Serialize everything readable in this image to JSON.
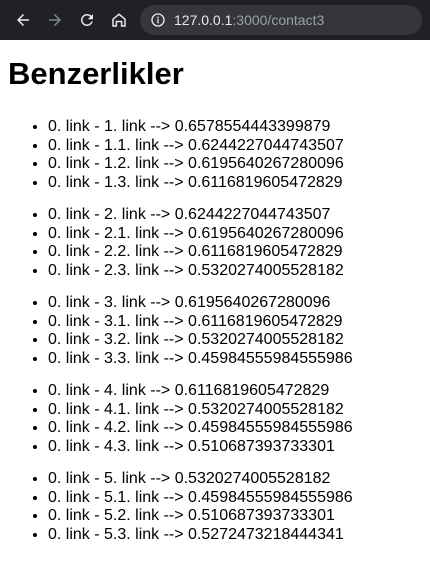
{
  "browser": {
    "url_host": "127.0.0.1",
    "url_rest": ":3000/contact3"
  },
  "page": {
    "title": "Benzerlikler",
    "groups": [
      {
        "items": [
          "0. link - 1. link --> 0.6578554443399879",
          "0. link - 1.1. link --> 0.6244227044743507",
          "0. link - 1.2. link --> 0.6195640267280096",
          "0. link - 1.3. link --> 0.6116819605472829"
        ]
      },
      {
        "items": [
          "0. link - 2. link --> 0.6244227044743507",
          "0. link - 2.1. link --> 0.6195640267280096",
          "0. link - 2.2. link --> 0.6116819605472829",
          "0. link - 2.3. link --> 0.5320274005528182"
        ]
      },
      {
        "items": [
          "0. link - 3. link --> 0.6195640267280096",
          "0. link - 3.1. link --> 0.6116819605472829",
          "0. link - 3.2. link --> 0.5320274005528182",
          "0. link - 3.3. link --> 0.45984555984555986"
        ]
      },
      {
        "items": [
          "0. link - 4. link --> 0.6116819605472829",
          "0. link - 4.1. link --> 0.5320274005528182",
          "0. link - 4.2. link --> 0.45984555984555986",
          "0. link - 4.3. link --> 0.510687393733301"
        ]
      },
      {
        "items": [
          "0. link - 5. link --> 0.5320274005528182",
          "0. link - 5.1. link --> 0.45984555984555986",
          "0. link - 5.2. link --> 0.510687393733301",
          "0. link - 5.3. link --> 0.5272473218444341"
        ]
      }
    ]
  }
}
